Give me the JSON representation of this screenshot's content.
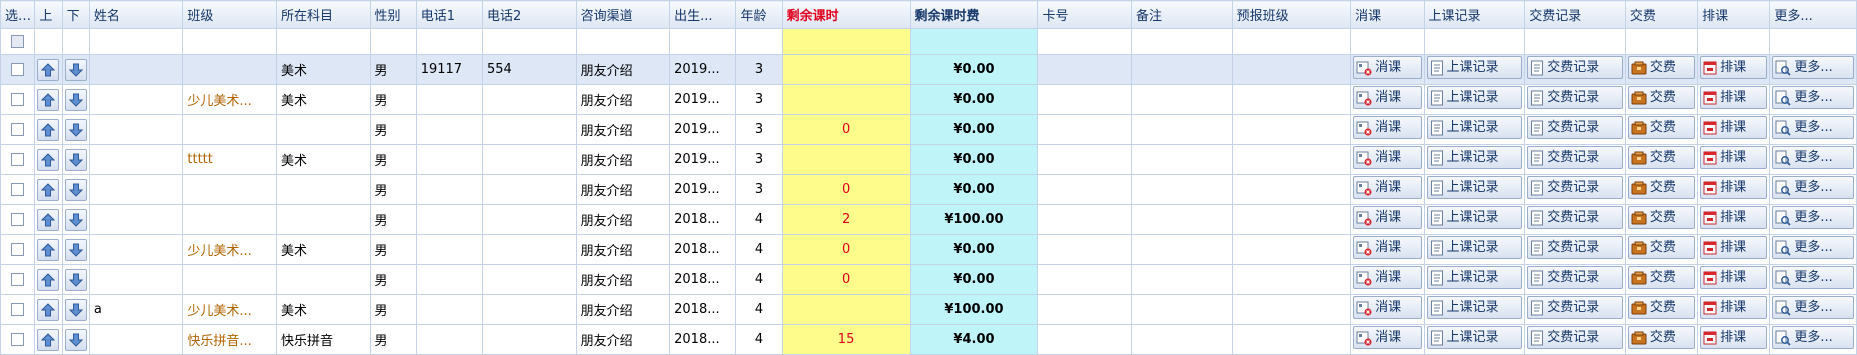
{
  "headers": {
    "select": "选...",
    "up": "上",
    "down": "下",
    "name": "姓名",
    "class": "班级",
    "subject": "所在科目",
    "gender": "性别",
    "phone1": "电话1",
    "phone2": "电话2",
    "channel": "咨询渠道",
    "birth": "出生...",
    "age": "年龄",
    "remain_hours": "剩余课时",
    "remain_fee": "剩余课时费",
    "card": "卡号",
    "note": "备注",
    "pre_class": "预报班级",
    "consume": "消课",
    "attend_record": "上课记录",
    "pay_record": "交费记录",
    "pay": "交费",
    "schedule": "排课",
    "more": "更多..."
  },
  "actions": {
    "consume": "消课",
    "attend_record": "上课记录",
    "pay_record": "交费记录",
    "pay": "交费",
    "schedule": "排课",
    "more": "更多..."
  },
  "rows": [
    {
      "name": "",
      "class": "",
      "subject": "美术",
      "gender": "男",
      "phone1": "19117",
      "phone2": "554",
      "channel": "朋友介绍",
      "birth": "2019...",
      "age": "3",
      "hours": "",
      "fee": "¥0.00",
      "card": "",
      "note": "",
      "selected": true
    },
    {
      "name": "",
      "class": "少儿美术...",
      "subject": "美术",
      "gender": "男",
      "phone1": "",
      "phone2": "",
      "channel": "朋友介绍",
      "birth": "2019...",
      "age": "3",
      "hours": "",
      "fee": "¥0.00",
      "card": "",
      "note": "",
      "selected": false
    },
    {
      "name": "",
      "class": "",
      "subject": "",
      "gender": "男",
      "phone1": "",
      "phone2": "",
      "channel": "朋友介绍",
      "birth": "2019...",
      "age": "3",
      "hours": "0",
      "fee": "¥0.00",
      "card": "",
      "note": "",
      "selected": false
    },
    {
      "name": "",
      "class": "ttttt",
      "subject": "美术",
      "gender": "男",
      "phone1": "",
      "phone2": "",
      "channel": "朋友介绍",
      "birth": "2019...",
      "age": "3",
      "hours": "",
      "fee": "¥0.00",
      "card": "",
      "note": "",
      "selected": false
    },
    {
      "name": "",
      "class": "",
      "subject": "",
      "gender": "男",
      "phone1": "",
      "phone2": "",
      "channel": "朋友介绍",
      "birth": "2019...",
      "age": "3",
      "hours": "0",
      "fee": "¥0.00",
      "card": "",
      "note": "",
      "selected": false
    },
    {
      "name": "",
      "class": "",
      "subject": "",
      "gender": "男",
      "phone1": "",
      "phone2": "",
      "channel": "朋友介绍",
      "birth": "2018...",
      "age": "4",
      "hours": "2",
      "fee": "¥100.00",
      "card": "",
      "note": "",
      "selected": false
    },
    {
      "name": "",
      "class": "少儿美术...",
      "subject": "美术",
      "gender": "男",
      "phone1": "",
      "phone2": "",
      "channel": "朋友介绍",
      "birth": "2018...",
      "age": "4",
      "hours": "0",
      "fee": "¥0.00",
      "card": "",
      "note": "",
      "selected": false
    },
    {
      "name": "",
      "class": "",
      "subject": "",
      "gender": "男",
      "phone1": "",
      "phone2": "",
      "channel": "朋友介绍",
      "birth": "2018...",
      "age": "4",
      "hours": "0",
      "fee": "¥0.00",
      "card": "",
      "note": "",
      "selected": false
    },
    {
      "name": "a",
      "class": "少儿美术...",
      "subject": "美术",
      "gender": "男",
      "phone1": "",
      "phone2": "",
      "channel": "朋友介绍",
      "birth": "2018...",
      "age": "4",
      "hours": "",
      "fee": "¥100.00",
      "card": "",
      "note": "",
      "selected": false
    },
    {
      "name": "",
      "class": "快乐拼音...",
      "subject": "快乐拼音",
      "gender": "男",
      "phone1": "",
      "phone2": "",
      "channel": "朋友介绍",
      "birth": "2018...",
      "age": "4",
      "hours": "15",
      "fee": "¥4.00",
      "card": "",
      "note": "",
      "selected": false
    }
  ]
}
